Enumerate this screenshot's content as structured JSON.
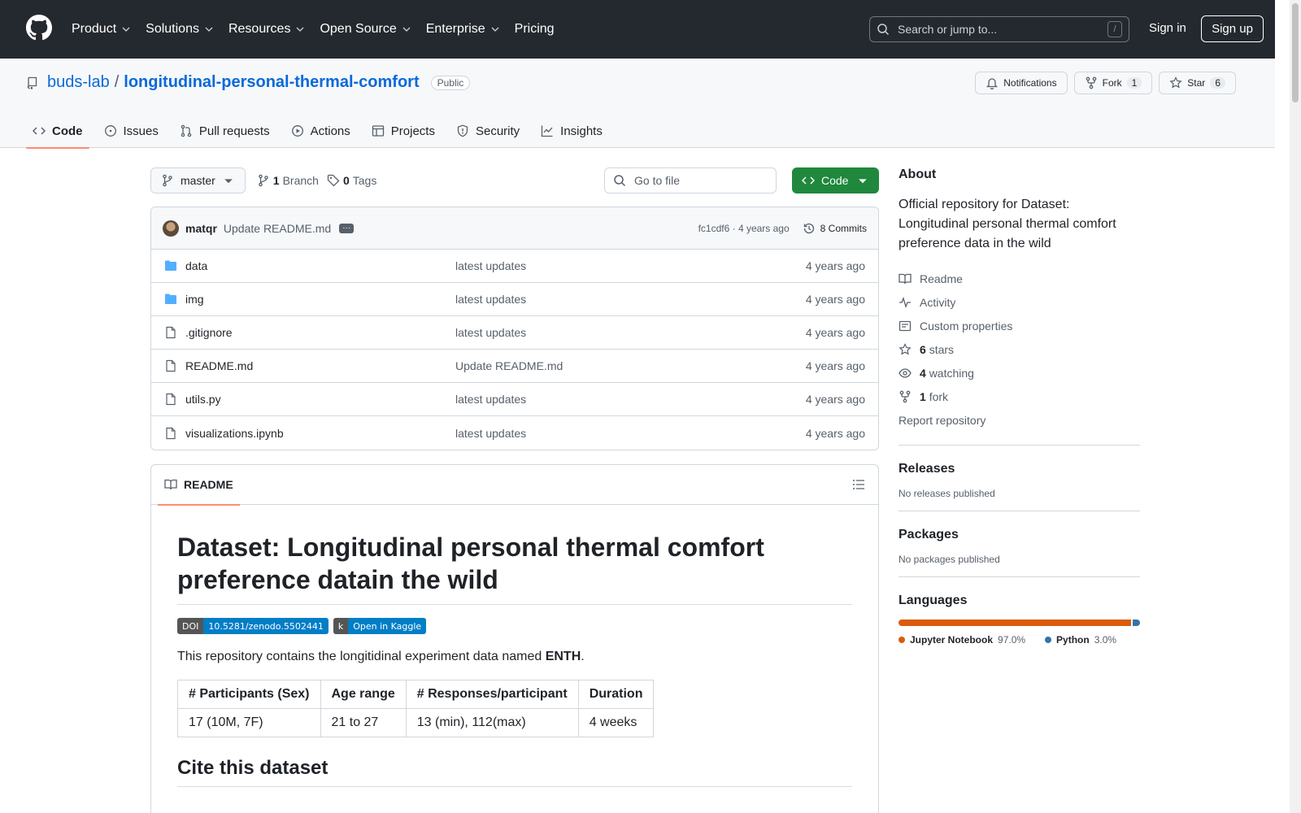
{
  "nav": {
    "items": [
      "Product",
      "Solutions",
      "Resources",
      "Open Source",
      "Enterprise",
      "Pricing"
    ],
    "search_placeholder": "Search or jump to...",
    "search_shortcut": "/",
    "signin": "Sign in",
    "signup": "Sign up"
  },
  "repo": {
    "owner": "buds-lab",
    "separator": "/",
    "name": "longitudinal-personal-thermal-comfort",
    "visibility": "Public",
    "notifications_label": "Notifications",
    "fork_label": "Fork",
    "fork_count": "1",
    "star_label": "Star",
    "star_count": "6"
  },
  "tabs": [
    "Code",
    "Issues",
    "Pull requests",
    "Actions",
    "Projects",
    "Security",
    "Insights"
  ],
  "branchbar": {
    "branch": "master",
    "branch_count": "1",
    "branch_label": "Branch",
    "tag_count": "0",
    "tag_label": "Tags",
    "goto_placeholder": "Go to file",
    "code_label": "Code"
  },
  "commit": {
    "user": "matqr",
    "message": "Update README.md",
    "hash_time": "fc1cdf6 · 4 years ago",
    "commits": "8 Commits"
  },
  "files": [
    {
      "name": "data",
      "type": "folder",
      "message": "latest updates",
      "date": "4 years ago"
    },
    {
      "name": "img",
      "type": "folder",
      "message": "latest updates",
      "date": "4 years ago"
    },
    {
      "name": ".gitignore",
      "type": "file",
      "message": "latest updates",
      "date": "4 years ago"
    },
    {
      "name": "README.md",
      "type": "file",
      "message": "Update README.md",
      "date": "4 years ago"
    },
    {
      "name": "utils.py",
      "type": "file",
      "message": "latest updates",
      "date": "4 years ago"
    },
    {
      "name": "visualizations.ipynb",
      "type": "file",
      "message": "latest updates",
      "date": "4 years ago"
    }
  ],
  "readme": {
    "tab_label": "README",
    "title": "Dataset: Longitudinal personal thermal comfort preference datain the wild",
    "badge_doi_left": "DOI",
    "badge_doi_right": "10.5281/zenodo.5502441",
    "badge_kaggle_left": "k",
    "badge_kaggle_right": "Open in Kaggle",
    "intro_before": "This repository contains the longitidinal experiment data named ",
    "intro_bold": "ENTH",
    "intro_after": ".",
    "table_headers": [
      "# Participants (Sex)",
      "Age range",
      "# Responses/participant",
      "Duration"
    ],
    "table_row": [
      "17 (10M, 7F)",
      "21 to 27",
      "13 (min), 112(max)",
      "4 weeks"
    ],
    "cite_heading": "Cite this dataset"
  },
  "about": {
    "heading": "About",
    "description": "Official repository for Dataset: Longitudinal personal thermal comfort preference data in the wild",
    "readme": "Readme",
    "activity": "Activity",
    "custom_properties": "Custom properties",
    "stars_count": "6",
    "stars_label": "stars",
    "watching_count": "4",
    "watching_label": "watching",
    "fork_count": "1",
    "fork_label": "fork",
    "report": "Report repository"
  },
  "releases": {
    "heading": "Releases",
    "empty": "No releases published"
  },
  "packages": {
    "heading": "Packages",
    "empty": "No packages published"
  },
  "languages": {
    "heading": "Languages",
    "items": [
      {
        "name": "Jupyter Notebook",
        "percent": "97.0%",
        "value": 97.0,
        "color": "#DA5B0B"
      },
      {
        "name": "Python",
        "percent": "3.0%",
        "value": 3.0,
        "color": "#3572A5"
      }
    ]
  }
}
